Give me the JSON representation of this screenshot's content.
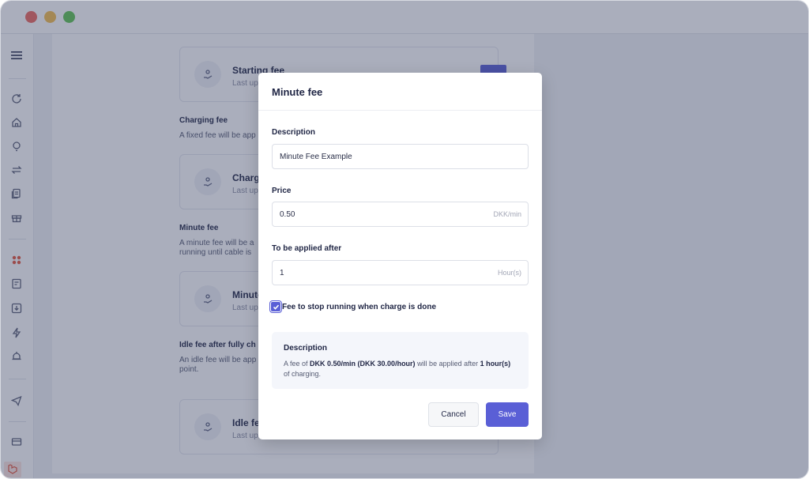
{
  "window": {
    "controls": [
      {
        "color": "#ee6a5f"
      },
      {
        "color": "#f5bd4f"
      },
      {
        "color": "#61c454"
      }
    ]
  },
  "sidebar": {
    "icons": [
      "menu-icon",
      "refresh-icon",
      "home-icon",
      "lightbulb-icon",
      "swap-icon",
      "documents-icon",
      "gift-icon",
      "grid-icon",
      "receipt-icon",
      "download-icon",
      "bolt-icon",
      "alarm-icon",
      "send-icon",
      "card-icon",
      "laravel-icon"
    ],
    "active_color": "#e5573f"
  },
  "background": {
    "cards": [
      {
        "title": "Starting fee",
        "subtitle": "Last up"
      },
      {
        "title": "Charg",
        "subtitle": "Last up"
      },
      {
        "title": "Minute",
        "subtitle": "Last up"
      },
      {
        "title": "Idle fe",
        "subtitle": "Last up"
      }
    ],
    "sections": [
      {
        "heading": "Charging fee",
        "text": "A fixed fee will be app"
      },
      {
        "heading": "Minute fee",
        "text": "A minute fee will be a",
        "text2": "running until cable is"
      },
      {
        "heading": "Idle fee after fully ch",
        "text": "An idle fee will be app",
        "text2": "point."
      }
    ]
  },
  "modal": {
    "title": "Minute fee",
    "description_label": "Description",
    "description_value": "Minute Fee Example",
    "price_label": "Price",
    "price_value": "0.50",
    "price_unit": "DKK/min",
    "applied_after_label": "To be applied after",
    "applied_after_value": "1",
    "applied_after_unit": "Hour(s)",
    "checkbox_label": "Fee to stop running when charge is done",
    "checkbox_checked": true,
    "summary": {
      "heading": "Description",
      "text_a": "A fee of ",
      "bold_a": "DKK 0.50/min (DKK 30.00/hour)",
      "text_b": " will be applied after ",
      "bold_b": "1 hour(s)",
      "text_c": " of charging."
    },
    "cancel_label": "Cancel",
    "save_label": "Save",
    "accent_color": "#5a5fd6"
  }
}
